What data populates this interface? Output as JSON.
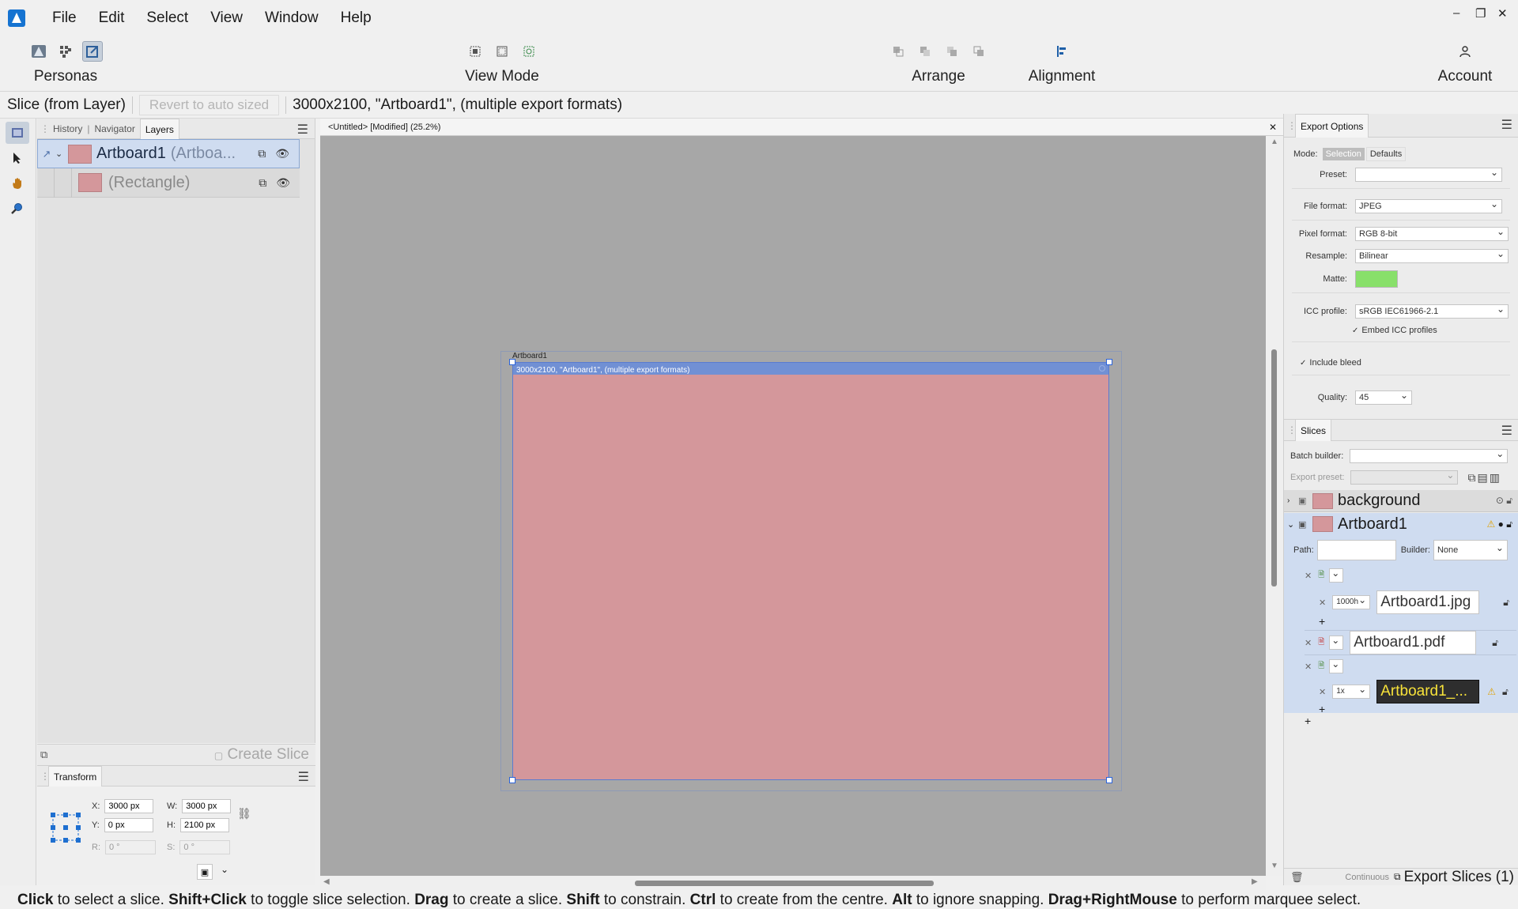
{
  "menu": {
    "items": [
      "File",
      "Edit",
      "Select",
      "View",
      "Window",
      "Help"
    ]
  },
  "window_controls": {
    "minimize": "–",
    "restore": "❐",
    "close": "✕"
  },
  "toolbar": {
    "personas_label": "Personas",
    "view_mode_label": "View Mode",
    "arrange_label": "Arrange",
    "alignment_label": "Alignment",
    "account_label": "Account"
  },
  "context_bar": {
    "tool_name": "Slice (from Layer)",
    "revert_label": "Revert to auto sized",
    "info": "3000x2100, \"Artboard1\", (multiple export formats)"
  },
  "left_panel": {
    "tabs": [
      "History",
      "Navigator",
      "Layers"
    ],
    "active_tab": "Layers",
    "layers": [
      {
        "name": "Artboard1",
        "type": "(Artboa..."
      },
      {
        "name": "(Rectangle)"
      }
    ],
    "create_slice_label": "Create Slice"
  },
  "transform": {
    "title": "Transform",
    "x_label": "X:",
    "x_value": "3000 px",
    "y_label": "Y:",
    "y_value": "0 px",
    "w_label": "W:",
    "w_value": "3000 px",
    "h_label": "H:",
    "h_value": "2100 px",
    "r_label": "R:",
    "r_value": "0 °",
    "s_label": "S:",
    "s_value": "0 °"
  },
  "document": {
    "tab_title": "<Untitled> [Modified] (25.2%)",
    "artboard_name": "Artboard1",
    "slice_info": "3000x2100, \"Artboard1\", (multiple export formats)",
    "artboard_color": "#d4979b"
  },
  "export_options": {
    "title": "Export Options",
    "mode_label": "Mode:",
    "mode_selection": "Selection",
    "mode_defaults": "Defaults",
    "preset_label": "Preset:",
    "preset_value": "",
    "file_format_label": "File format:",
    "file_format_value": "JPEG",
    "pixel_format_label": "Pixel format:",
    "pixel_format_value": "RGB 8-bit",
    "resample_label": "Resample:",
    "resample_value": "Bilinear",
    "matte_label": "Matte:",
    "matte_color": "#88e06a",
    "icc_label": "ICC profile:",
    "icc_value": "sRGB IEC61966-2.1",
    "embed_icc_label": "Embed ICC profiles",
    "include_bleed_label": "Include bleed",
    "quality_label": "Quality:",
    "quality_value": "45"
  },
  "slices": {
    "title": "Slices",
    "batch_builder_label": "Batch builder:",
    "export_preset_label": "Export preset:",
    "items": [
      {
        "name": "background"
      },
      {
        "name": "Artboard1"
      }
    ],
    "path_label": "Path:",
    "builder_label": "Builder:",
    "builder_value": "None",
    "formats": [
      {
        "scale": "1000h",
        "filename": "Artboard1.jpg"
      },
      {
        "filename": "Artboard1.pdf"
      },
      {
        "scale": "1x",
        "filename": "Artboard1_..."
      }
    ],
    "continuous_label": "Continuous",
    "export_button_label": "Export Slices (1)"
  },
  "status_bar": {
    "parts": [
      {
        "b": "Click",
        "t": " to select a slice. "
      },
      {
        "b": "Shift+Click",
        "t": " to toggle slice selection. "
      },
      {
        "b": "Drag",
        "t": " to create a slice. "
      },
      {
        "b": "Shift",
        "t": " to constrain. "
      },
      {
        "b": "Ctrl",
        "t": " to create from the centre. "
      },
      {
        "b": "Alt",
        "t": " to ignore snapping. "
      },
      {
        "b": "Drag+RightMouse",
        "t": " to perform marquee select."
      }
    ]
  }
}
